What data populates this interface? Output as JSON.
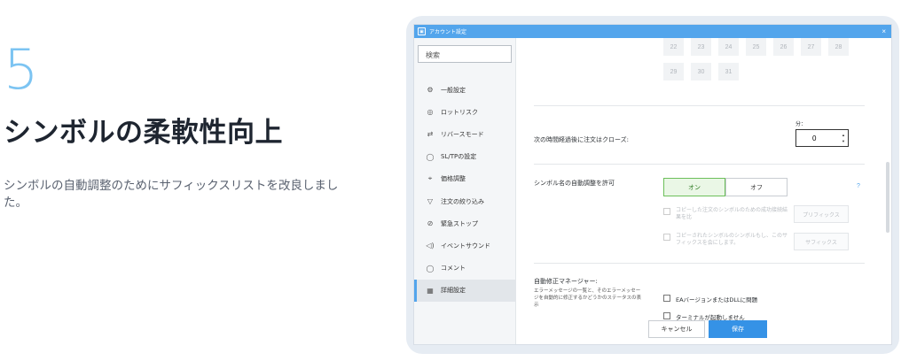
{
  "promo": {
    "step": "5",
    "title": "シンボルの柔軟性向上",
    "description": "シンボルの自動調整のためにサフィックスリストを改良しました。"
  },
  "window": {
    "title": "アカウント設定",
    "close": "×",
    "app_icon": "account-settings-icon"
  },
  "sidebar": {
    "search_placeholder": "検索",
    "items": [
      {
        "label": "一般設定",
        "icon": "⚙"
      },
      {
        "label": "ロットリスク",
        "icon": "◎"
      },
      {
        "label": "リバースモード",
        "icon": "⇄"
      },
      {
        "label": "SL/TPの設定",
        "icon": "◯"
      },
      {
        "label": "価格調整",
        "icon": "⌖"
      },
      {
        "label": "注文の絞り込み",
        "icon": "▽"
      },
      {
        "label": "緊急ストップ",
        "icon": "⊘"
      },
      {
        "label": "イベントサウンド",
        "icon": "◁)"
      },
      {
        "label": "コメント",
        "icon": "◯"
      },
      {
        "label": "詳細設定",
        "icon": "▦"
      }
    ],
    "active_index": 9
  },
  "calendar": {
    "row1": [
      "22",
      "23",
      "24",
      "25",
      "26",
      "27",
      "28"
    ],
    "row2": [
      "29",
      "30",
      "31"
    ]
  },
  "close_after": {
    "label": "次の時間経過後に注文はクローズ:",
    "unit": "分：",
    "value": "0"
  },
  "symbol_auto": {
    "label": "シンボル名の自動調整を許可",
    "on": "オン",
    "off": "オフ",
    "help": "?",
    "option1": "コピーした注文のシンボルのための成功接続結果を比",
    "option1_button": "プリフィックス",
    "option2": "コピーされたシンボルのシンボルもし、このサフィックスを会にします。",
    "option2_button": "サフィックス"
  },
  "auto_fix": {
    "title": "自動修正マネージャー:",
    "description": "エラーメッセージの一覧と、そのエラーメッセージを自動的に修正するかどうかのステータスの表示",
    "check1": "EAバージョンまたはDLLに問題",
    "check2": "ターミナルが起動しません"
  },
  "footer": {
    "cancel": "キャンセル",
    "save": "保存"
  }
}
